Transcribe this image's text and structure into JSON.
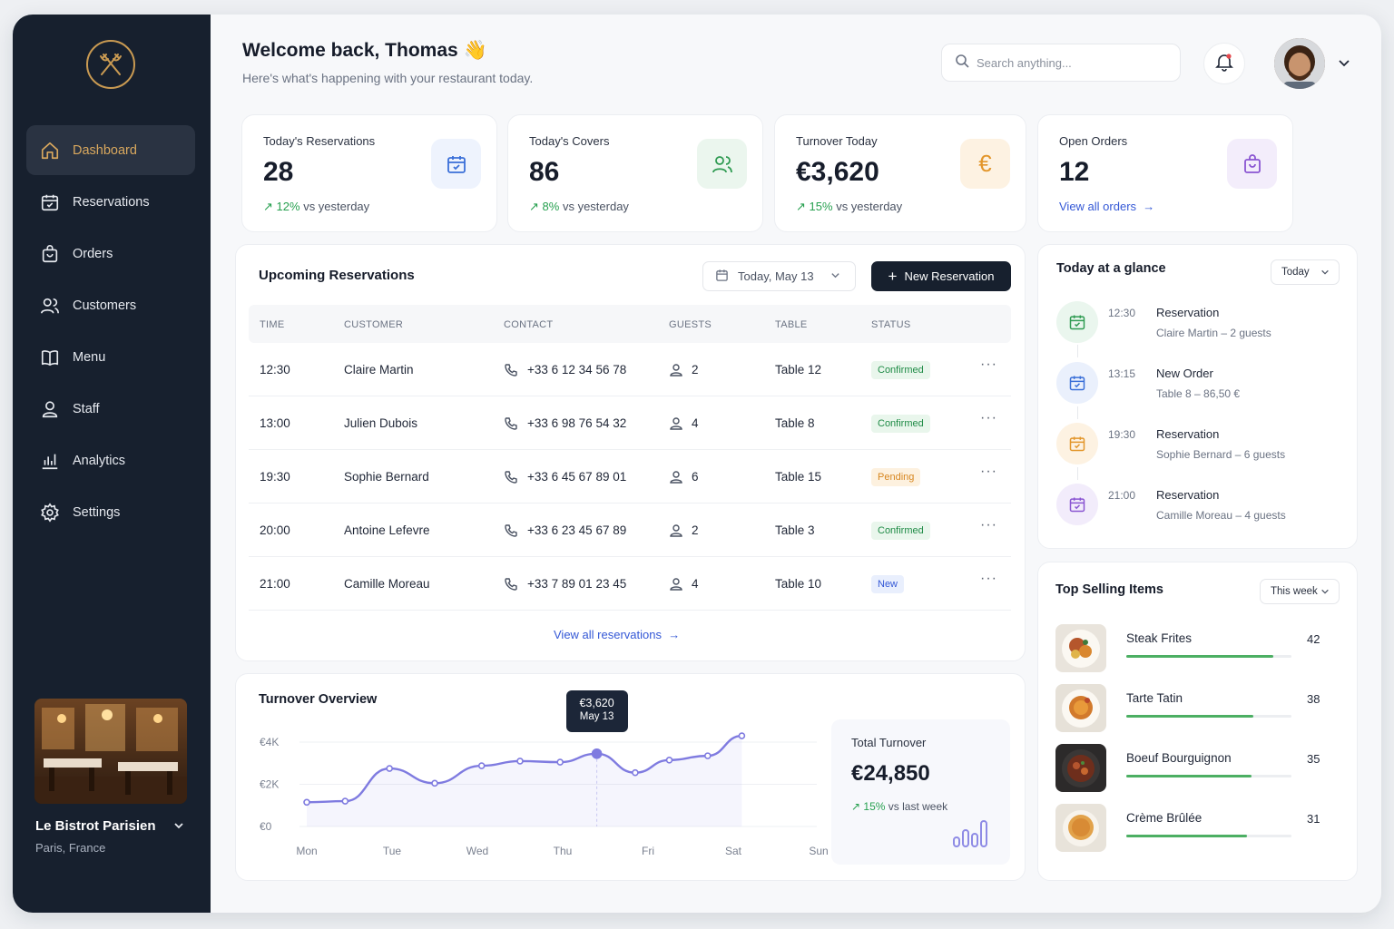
{
  "sidebar": {
    "nav": [
      {
        "label": "Dashboard",
        "icon": "home-icon",
        "active": true
      },
      {
        "label": "Reservations",
        "icon": "calendar-icon"
      },
      {
        "label": "Orders",
        "icon": "bag-icon"
      },
      {
        "label": "Customers",
        "icon": "users-icon"
      },
      {
        "label": "Menu",
        "icon": "book-icon"
      },
      {
        "label": "Staff",
        "icon": "user-icon"
      },
      {
        "label": "Analytics",
        "icon": "bar-chart-icon"
      },
      {
        "label": "Settings",
        "icon": "gear-icon"
      }
    ],
    "restaurant": {
      "name": "Le Bistrot Parisien",
      "location": "Paris, France"
    }
  },
  "header": {
    "welcome": "Welcome back, Thomas 👋",
    "subtitle": "Here's what's happening with your restaurant today.",
    "search_placeholder": "Search anything..."
  },
  "stats": [
    {
      "title": "Today's Reservations",
      "value": "28",
      "change": "12%",
      "change_text": "vs yesterday",
      "icon": "calendar-icon"
    },
    {
      "title": "Today's Covers",
      "value": "86",
      "change": "8%",
      "change_text": "vs yesterday",
      "icon": "users-icon"
    },
    {
      "title": "Turnover Today",
      "value": "€3,620",
      "change": "15%",
      "change_text": "vs yesterday",
      "icon": "euro-icon"
    },
    {
      "title": "Open Orders",
      "value": "12",
      "link": "View all orders",
      "icon": "bag-icon"
    }
  ],
  "reservations": {
    "title": "Upcoming Reservations",
    "date_label": "Today, May 13",
    "new_button": "New Reservation",
    "columns": [
      "TIME",
      "CUSTOMER",
      "CONTACT",
      "GUESTS",
      "TABLE",
      "STATUS"
    ],
    "rows": [
      {
        "time": "12:30",
        "customer": "Claire Martin",
        "contact": "+33 6 12 34 56 78",
        "guests": "2",
        "table": "Table 12",
        "status": "Confirmed"
      },
      {
        "time": "13:00",
        "customer": "Julien Dubois",
        "contact": "+33 6 98 76 54 32",
        "guests": "4",
        "table": "Table 8",
        "status": "Confirmed"
      },
      {
        "time": "19:30",
        "customer": "Sophie Bernard",
        "contact": "+33 6 45 67 89 01",
        "guests": "6",
        "table": "Table 15",
        "status": "Pending"
      },
      {
        "time": "20:00",
        "customer": "Antoine Lefevre",
        "contact": "+33 6 23 45 67 89",
        "guests": "2",
        "table": "Table 3",
        "status": "Confirmed"
      },
      {
        "time": "21:00",
        "customer": "Camille Moreau",
        "contact": "+33 7 89 01 23 45",
        "guests": "4",
        "table": "Table 10",
        "status": "New"
      }
    ],
    "view_all": "View all reservations"
  },
  "turnover": {
    "title": "Turnover Overview",
    "tooltip_value": "€3,620",
    "tooltip_date": "May 13",
    "total_label": "Total Turnover",
    "total_value": "€24,850",
    "total_change": "15%",
    "total_change_text": "vs last week"
  },
  "chart_data": {
    "type": "line",
    "x_labels": [
      "Mon",
      "Tue",
      "Wed",
      "Thu",
      "Fri",
      "Sat",
      "Sun"
    ],
    "y_labels": [
      "€4K",
      "€2K",
      "€0"
    ],
    "ylim": [
      0,
      4000
    ],
    "series": [
      {
        "points": [
          [
            0,
            1150
          ],
          [
            0.45,
            1200
          ],
          [
            0.97,
            2750
          ],
          [
            1.5,
            2050
          ],
          [
            2.05,
            2880
          ],
          [
            2.5,
            3100
          ],
          [
            2.97,
            3050
          ],
          [
            3.4,
            3450
          ],
          [
            3.85,
            2550
          ],
          [
            4.25,
            3150
          ],
          [
            4.7,
            3350
          ],
          [
            5.1,
            4300
          ]
        ]
      }
    ],
    "highlight": {
      "x": 3.4,
      "y": 3450
    },
    "color": "#7f7be0",
    "grid": true
  },
  "glance": {
    "title": "Today at a glance",
    "filter": "Today",
    "items": [
      {
        "time": "12:30",
        "title": "Reservation",
        "desc": "Claire Martin – 2 guests",
        "icon": "calendar-icon",
        "color": "#2f9b52",
        "bg": "#eaf6ee"
      },
      {
        "time": "13:15",
        "title": "New Order",
        "desc": "Table 8 – 86,50 €",
        "icon": "calendar-icon",
        "color": "#3a6fd8",
        "bg": "#eaf0fc"
      },
      {
        "time": "19:30",
        "title": "Reservation",
        "desc": "Sophie Bernard – 6 guests",
        "icon": "calendar-icon",
        "color": "#e3962b",
        "bg": "#fdf2e2"
      },
      {
        "time": "21:00",
        "title": "Reservation",
        "desc": "Camille Moreau – 4 guests",
        "icon": "calendar-icon",
        "color": "#8a55d2",
        "bg": "#f2ecfb"
      }
    ]
  },
  "top_selling": {
    "title": "Top Selling Items",
    "filter": "This week",
    "items": [
      {
        "name": "Steak Frites",
        "count": "42",
        "fill": 0.89
      },
      {
        "name": "Tarte Tatin",
        "count": "38",
        "fill": 0.77
      },
      {
        "name": "Boeuf Bourguignon",
        "count": "35",
        "fill": 0.76
      },
      {
        "name": "Crème Brûlée",
        "count": "31",
        "fill": 0.73
      }
    ]
  },
  "colors": {
    "sidebar": "#17202e",
    "accent_gold": "#d9a85e",
    "link": "#3458d6",
    "positive": "#27a050"
  }
}
